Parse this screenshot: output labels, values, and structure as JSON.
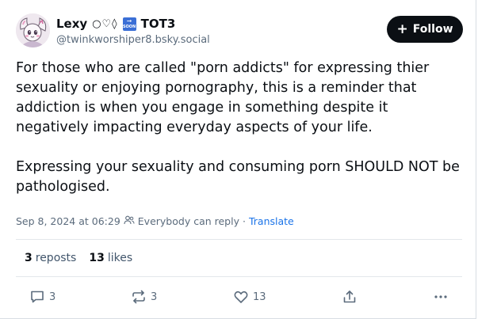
{
  "author": {
    "display_name": "Lexy",
    "name_symbols": "○♡◊",
    "badge_text": "SOON",
    "badge_icon": "soon-arrow-icon",
    "name_suffix": "TOT3",
    "handle": "@twinkworshiper8.bsky.social"
  },
  "follow": {
    "label": "Follow",
    "icon": "plus-icon"
  },
  "post": {
    "paragraph1": "For those who are called \"porn addicts\" for expressing thier sexuality or enjoying pornography, this is a reminder that addiction is when you engage in something despite it negatively impacting everyday aspects of your life.",
    "paragraph2": "Expressing your sexuality and consuming porn SHOULD NOT be pathologised."
  },
  "meta": {
    "timestamp": "Sep 8, 2024 at 06:29",
    "reply_setting_icon": "people-icon",
    "reply_setting": "Everybody can reply",
    "separator": "·",
    "translate_label": "Translate"
  },
  "stats": {
    "reposts_count": "3",
    "reposts_label": "reposts",
    "likes_count": "13",
    "likes_label": "likes"
  },
  "actions": {
    "reply_count": "3",
    "repost_count": "3",
    "like_count": "13"
  },
  "colors": {
    "text": "#0b0f14",
    "muted": "#5b6b7c",
    "link": "#1a73e8",
    "follow_bg": "#0b0f14",
    "divider": "#e3e7eb"
  }
}
